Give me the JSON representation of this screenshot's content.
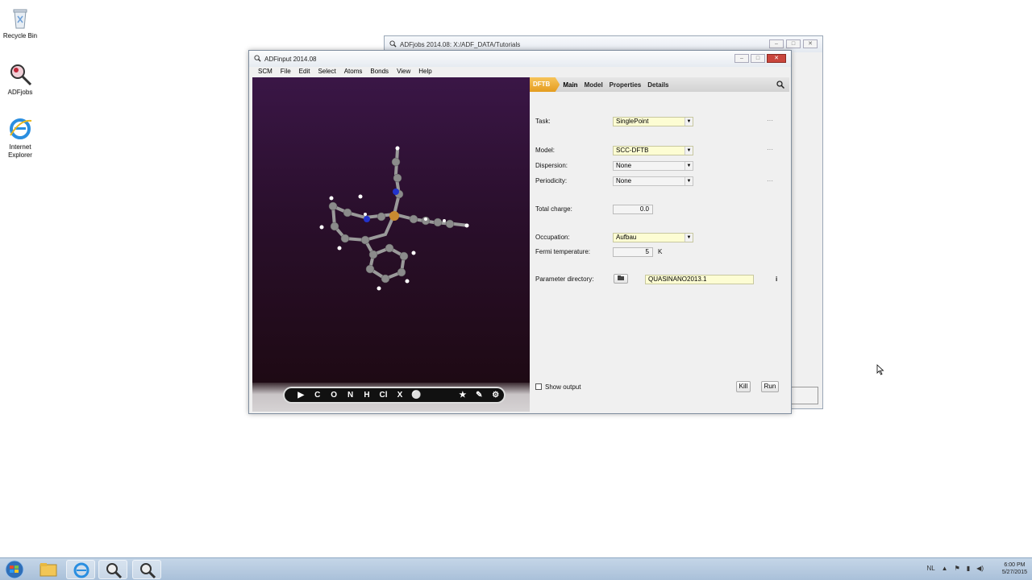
{
  "desktop": {
    "icons": [
      {
        "label": "Recycle Bin"
      },
      {
        "label": "ADFjobs"
      },
      {
        "label": "Internet Explorer"
      }
    ]
  },
  "back_window": {
    "title": "ADFjobs 2014.08: X:/ADF_DATA/Tutorials"
  },
  "main_window": {
    "title": "ADFinput 2014.08",
    "menu": [
      "SCM",
      "File",
      "Edit",
      "Select",
      "Atoms",
      "Bonds",
      "View",
      "Help"
    ],
    "toolbar_tools": [
      "▶",
      "C",
      "O",
      "N",
      "H",
      "Cl",
      "X",
      "⚪",
      "★",
      "✎",
      "⚙"
    ],
    "panel": {
      "tabs": {
        "dftb": "DFTB",
        "main": "Main",
        "model": "Model",
        "properties": "Properties",
        "details": "Details"
      },
      "task": {
        "label": "Task:",
        "value": "SinglePoint"
      },
      "model": {
        "label": "Model:",
        "value": "SCC-DFTB"
      },
      "dispersion": {
        "label": "Dispersion:",
        "value": "None"
      },
      "periodicity": {
        "label": "Periodicity:",
        "value": "None"
      },
      "total_charge": {
        "label": "Total charge:",
        "value": "0.0"
      },
      "occupation": {
        "label": "Occupation:",
        "value": "Aufbau"
      },
      "fermi": {
        "label": "Fermi temperature:",
        "value": "5",
        "unit": "K"
      },
      "parameter_directory": {
        "label": "Parameter directory:",
        "value": "QUASINANO2013.1",
        "info": "i"
      },
      "show_output": "Show output",
      "kill": "Kill",
      "run": "Run"
    }
  },
  "taskbar": {
    "language": "NL",
    "time": "6:00 PM",
    "date": "5/27/2015"
  },
  "colors": {
    "viewer_top": "#3a1646",
    "viewer_bottom": "#1e0a14",
    "dftb_tab": "#e49c1f",
    "select_bg": "#fdfdd3"
  }
}
